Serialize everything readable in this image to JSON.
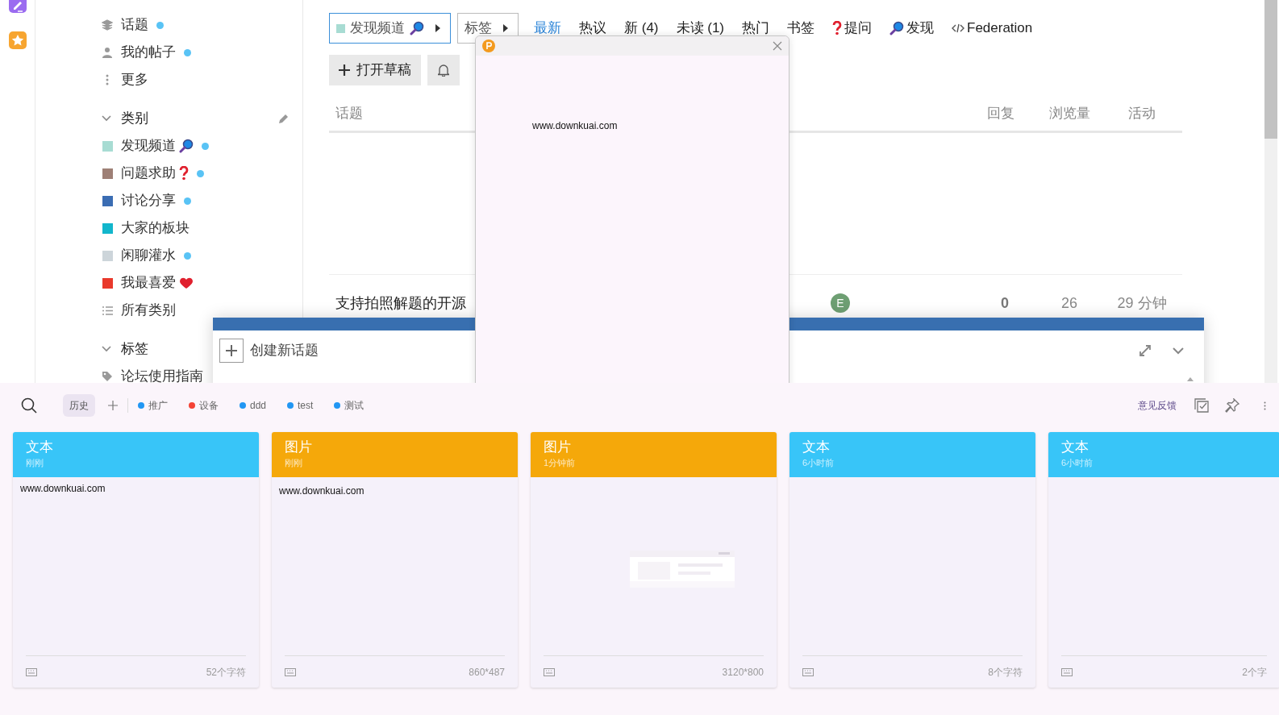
{
  "sidebar": {
    "items": [
      {
        "label": "话题",
        "unread": true
      },
      {
        "label": "我的帖子",
        "unread": true
      },
      {
        "label": "更多",
        "unread": false
      }
    ],
    "sections": [
      {
        "title": "类别",
        "expanded": true,
        "items": [
          {
            "label": "发现频道",
            "color": "#a8dcd3",
            "kind": "search",
            "unread": true
          },
          {
            "label": "问题求助",
            "color": "#9e8076",
            "kind": "question",
            "unread": true
          },
          {
            "label": "讨论分享",
            "color": "#3b6db3",
            "unread": true
          },
          {
            "label": "大家的板块",
            "color": "#12b6cc",
            "unread": false
          },
          {
            "label": "闲聊灌水",
            "color": "#cdd5da",
            "unread": true
          },
          {
            "label": "我最喜爱",
            "color": "#e9392c",
            "kind": "heart",
            "unread": false
          },
          {
            "label": "所有类别",
            "kind": "all",
            "unread": false
          }
        ]
      },
      {
        "title": "标签",
        "expanded": true,
        "items": [
          {
            "label": "论坛使用指南",
            "kind": "tag",
            "unread": false
          }
        ]
      }
    ]
  },
  "filters": [
    {
      "label": "发现频道",
      "color": "#a8dcd3",
      "kind": "search",
      "active": true
    },
    {
      "label": "标签",
      "active": false
    }
  ],
  "tabs": [
    {
      "label": "最新",
      "selected": true
    },
    {
      "label": "热议",
      "selected": false
    },
    {
      "label": "新 (4)",
      "selected": false
    },
    {
      "label": "未读 (1)",
      "selected": false
    },
    {
      "label": "热门",
      "selected": false
    },
    {
      "label": "书签",
      "selected": false
    },
    {
      "label": "提问",
      "kind": "question",
      "selected": false
    },
    {
      "label": "发现",
      "kind": "search",
      "selected": false
    },
    {
      "label": "Federation",
      "kind": "code",
      "selected": false
    }
  ],
  "buttons": [
    {
      "label": "打开草稿",
      "kind": "draft"
    },
    {
      "kind": "bell"
    }
  ],
  "table": {
    "columns": [
      "话题",
      "回复",
      "浏览量",
      "活动"
    ],
    "rows": [
      {
        "title": "支持拍照解题的开源",
        "poster": "E",
        "replies": "0",
        "views": "26",
        "activity": "29 分钟"
      }
    ]
  },
  "popup": {
    "body": "www.downkuai.com"
  },
  "composer": {
    "title": "创建新话题"
  },
  "clipboard": {
    "history": "历史",
    "tags": [
      {
        "label": "推广",
        "color": "#2196f3"
      },
      {
        "label": "设备",
        "color": "#f44336"
      },
      {
        "label": "ddd",
        "color": "#2196f3"
      },
      {
        "label": "test",
        "color": "#2196f3"
      },
      {
        "label": "测试",
        "color": "#2196f3"
      }
    ],
    "feedback": "意见反馈",
    "cards": [
      {
        "kind": "text",
        "title": "文本",
        "time": "刚刚",
        "content": "www.downkuai.com",
        "info": "52个字符"
      },
      {
        "title": "图片",
        "time": "刚刚",
        "content": "www.downkuai.com",
        "info": "860*487"
      },
      {
        "title": "图片",
        "time": "1分钟前",
        "info": "3120*800"
      },
      {
        "kind": "text",
        "title": "文本",
        "time": "6小时前",
        "info": "8个字符"
      },
      {
        "kind": "text",
        "title": "文本",
        "time": "6小时前",
        "info": "2个字"
      }
    ]
  }
}
